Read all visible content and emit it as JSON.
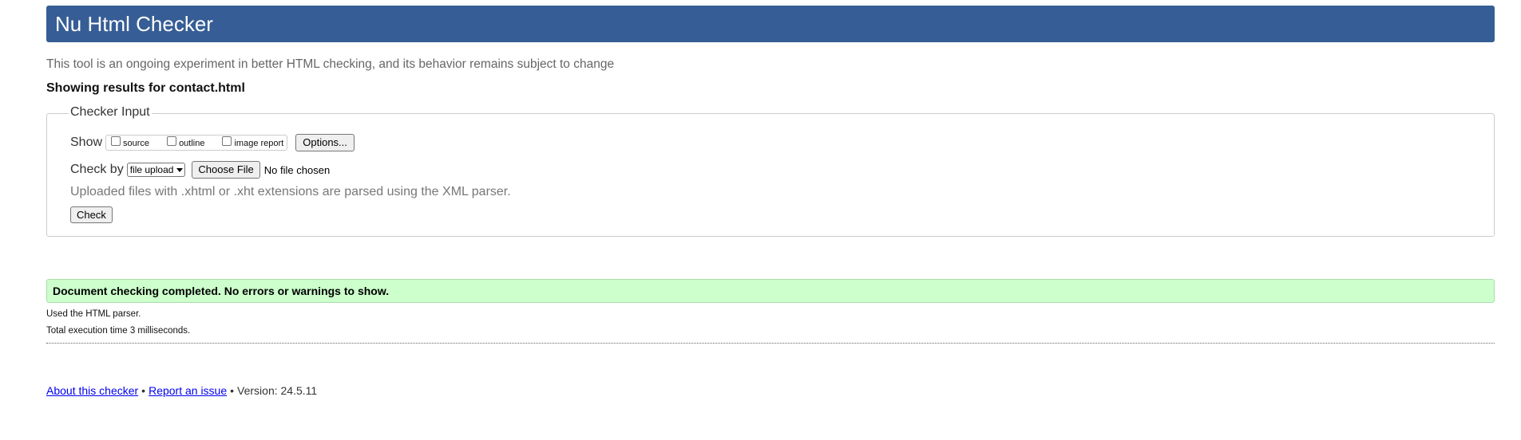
{
  "header": {
    "title": "Nu Html Checker",
    "background_color": "#365d95"
  },
  "intro": {
    "tagline": "This tool is an ongoing experiment in better HTML checking, and its behavior remains subject to change",
    "results_for": "Showing results for contact.html"
  },
  "checker_input": {
    "legend": "Checker Input",
    "show_label": "Show",
    "show_options": [
      {
        "label": "source",
        "checked": false
      },
      {
        "label": "outline",
        "checked": false
      },
      {
        "label": "image report",
        "checked": false
      }
    ],
    "options_button": "Options...",
    "check_by_label": "Check by",
    "check_by_selected": "file upload",
    "choose_file_button": "Choose File",
    "file_status": "No file chosen",
    "xml_note": "Uploaded files with .xhtml or .xht extensions are parsed using the XML parser.",
    "check_button": "Check"
  },
  "result": {
    "message": "Document checking completed. No errors or warnings to show.",
    "background_color": "#ccffcc",
    "parser_note": "Used the HTML parser.",
    "execution_time": "Total execution time 3 milliseconds."
  },
  "footer": {
    "about_link": "About this checker",
    "separator": "•",
    "report_link": "Report an issue",
    "version": "Version: 24.5.11"
  }
}
